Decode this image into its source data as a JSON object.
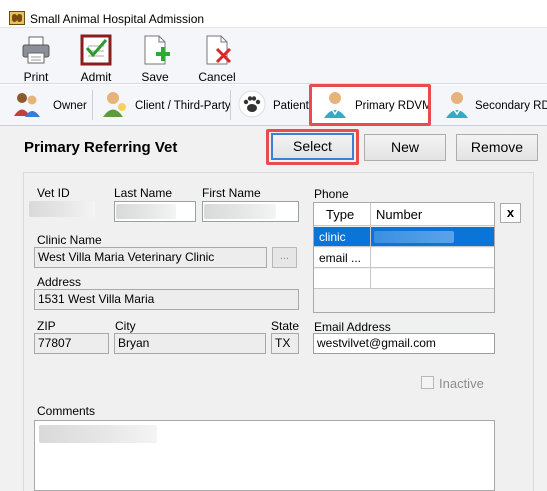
{
  "window": {
    "title": "Small Animal Hospital Admission"
  },
  "toolbar": {
    "print": "Print",
    "admit": "Admit",
    "save": "Save",
    "cancel": "Cancel"
  },
  "tabs": [
    {
      "label": "Owner",
      "icon": "owner-people-icon"
    },
    {
      "label": "Client / Third-Party",
      "icon": "client-person-icon"
    },
    {
      "label": "Patient",
      "icon": "paw-icon"
    },
    {
      "label": "Primary RDVM",
      "icon": "vet-doctor-icon",
      "active": true
    },
    {
      "label": "Secondary RDV",
      "icon": "vet-doctor-icon"
    }
  ],
  "section": {
    "heading": "Primary Referring Vet",
    "select": "Select",
    "new": "New",
    "remove": "Remove"
  },
  "form": {
    "vet_id_label": "Vet ID",
    "last_name_label": "Last Name",
    "first_name_label": "First Name",
    "clinic_name_label": "Clinic Name",
    "clinic_name": "West Villa Maria Veterinary Clinic",
    "clinic_lookup": "...",
    "address_label": "Address",
    "address": "1531 West Villa Maria",
    "zip_label": "ZIP",
    "zip": "77807",
    "city_label": "City",
    "city": "Bryan",
    "state_label": "State",
    "state": "TX",
    "phone_label": "Phone",
    "phone_columns": [
      "Type",
      "Number"
    ],
    "phone_rows": [
      {
        "type": "clinic",
        "number": ""
      },
      {
        "type": "email ...",
        "number": ""
      }
    ],
    "phone_delete": "x",
    "email_label": "Email Address",
    "email": "westvilvet@gmail.com",
    "inactive_label": "Inactive",
    "comments_label": "Comments"
  },
  "colors": {
    "highlight": "#e74c4f",
    "selection": "#0a74d9"
  }
}
